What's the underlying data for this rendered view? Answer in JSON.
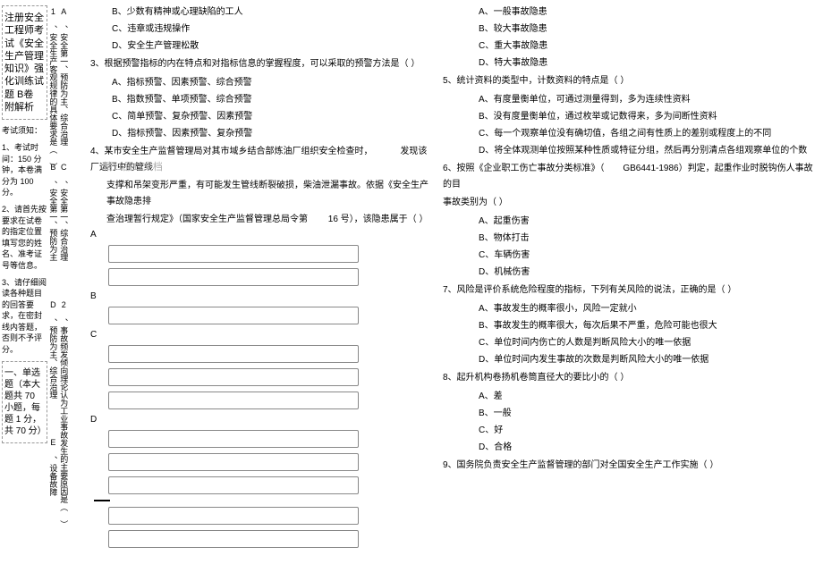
{
  "left": {
    "title_block": "注册安全工程师考试《安全生产管理知识》强化训练试题 B卷 附解析",
    "exam_notice_header": "考试须知：",
    "notice1": "1、考试时间：150 分钟，本卷满分为 100 分。",
    "notice2": "2、请首先按要求在试卷的指定位置填写您的姓名、准考证号等信息。",
    "notice3": "3、请仔细阅读各种题目的回答要求，在密封线内答题，否则不予评分。",
    "section1_header": "一、单选题（本大题共 70 小题，每题 1 分，共 70 分）",
    "v1": "1 、安全生产客观规律的具体要求是（     ）",
    "vA": "A 、安全第一、预防为主、综合治理",
    "vB": "B 、安全第一、预防为主",
    "vC": "C 、安全第一、综合治理",
    "vD": "D 、预防为主、综合治理",
    "v2": "2 、事故频发倾向理论认为工业事故发生的主要原因是（   ）",
    "vE": "E 、设备故障"
  },
  "mid": {
    "optB1": "B、少数有精神或心理缺陷的工人",
    "optC1": "C、违章或违规操作",
    "optD1": "D、安全生产管理松散",
    "q3": "3、根据预警指标的内在特点和对指标信息的掌握程度，可以采取的预警方法是（      ）",
    "q3A": "A、指标预警、因素预警、综合预警",
    "q3B": "B、指数预警、单项预警、综合预警",
    "q3C": "C、简单预警、复杂预警、因素预警",
    "q3D": "D、指标预警、因素预警、复杂预警",
    "q4_line1": "4、某市安全生产监督管理局对其市域乡结合部炼油厂组织安全检查时，",
    "q4_line1b": "发现该厂运行中的管线",
    "q4_line2": "支撑和吊架变形严重，有可能发生管线断裂破损，柴油泄漏事故。依据《安全生产事故隐患排",
    "q4_line3": "查治理暂行规定》（国家安全生产监督管理总局令第",
    "q4_line3b": "16 号），该隐患属于（        ）",
    "watermark": "精11品11文档",
    "labelA": "A",
    "labelB": "B",
    "labelC": "C",
    "labelD": "D"
  },
  "right": {
    "rA1": "A、一般事故隐患",
    "rB1": "B、较大事故隐患",
    "rC1": "C、重大事故隐患",
    "rD1": "D、特大事故隐患",
    "q5": "5、统计资料的类型中，计数资料的特点是（        ）",
    "q5A": "A、有度量衡单位，可通过测量得到，多为连续性资料",
    "q5B": "B、没有度量衡单位，通过枚举或记数得来，多为间断性资料",
    "q5C": "C、每一个观察单位没有确切值，各组之间有性质上的差别或程度上的不同",
    "q5D": "D、将全体观测单位按照某种性质或特征分组，然后再分别清点各组观察单位的个数",
    "q6a": "6、按照《企业职工伤亡事故分类标准》（",
    "q6b": "GB6441-1986）判定，起重作业时脱钩伤人事故的目",
    "q6c": "事故类别为（       ）",
    "q6A": "A、起重伤害",
    "q6B": "B、物体打击",
    "q6C": "C、车辆伤害",
    "q6D": "D、机械伤害",
    "q7": "7、风险是评价系统危险程度的指标，下列有关风险的说法，正确的是（           ）",
    "q7A": "A、事故发生的概率很小，风险一定就小",
    "q7B": "B、事故发生的概率很大，每次后果不严重，危险可能也很大",
    "q7C": "C、单位时间内伤亡的人数是判断风险大小的唯一依据",
    "q7D": "D、单位时间内发生事故的次数是判断风险大小的唯一依据",
    "q8": "8、起升机构卷扬机卷筒直径大的要比小的（          ）",
    "q8A": "A、差",
    "q8B": "B、一般",
    "q8C": "C、好",
    "q8D": "D、合格",
    "q9": "9、国务院负责安全生产监督管理的部门对全国安全生产工作实施（         ）"
  }
}
